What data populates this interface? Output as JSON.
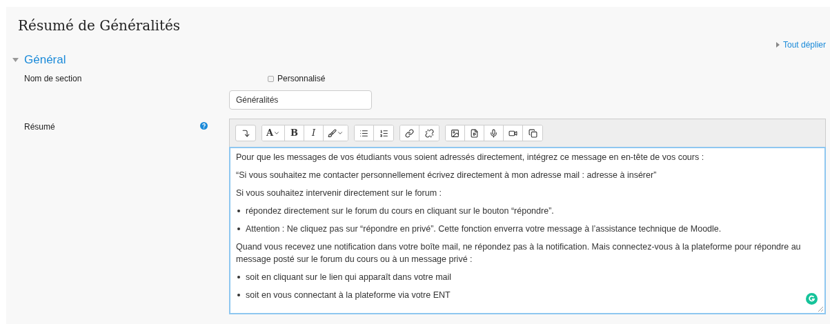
{
  "page_title": "Résumé de Généralités",
  "expand_all": "Tout déplier",
  "section": {
    "title": "Général",
    "expanded": true
  },
  "fields": {
    "name_label": "Nom de section",
    "custom_label": "Personnalisé",
    "custom_checked": false,
    "name_value": "Généralités",
    "summary_label": "Résumé"
  },
  "toolbar": {
    "font": "A",
    "bold": "B",
    "italic": "I"
  },
  "content": [
    {
      "kind": "p",
      "text": "Pour que les messages de vos étudiants vous soient adressés directement, intégrez ce message en en-tête de vos cours :"
    },
    {
      "kind": "p",
      "text": "“Si vous souhaitez me contacter personnellement écrivez directement à mon adresse mail : adresse à insérer”"
    },
    {
      "kind": "p",
      "text": "Si vous souhaitez intervenir directement sur le forum :"
    },
    {
      "kind": "li",
      "text": "répondez directement sur le forum du cours en cliquant sur le bouton “répondre”."
    },
    {
      "kind": "li",
      "text": "Attention : Ne cliquez pas sur “répondre en privé”. Cette fonction enverra votre message à l’assistance technique de Moodle."
    },
    {
      "kind": "p",
      "text": "Quand vous recevez une notification dans votre boîte mail, ne répondez pas à la notification. Mais connectez-vous à la plateforme pour répondre au message posté sur le forum du cours ou à un message privé :"
    },
    {
      "kind": "li",
      "text": "soit en cliquant sur le lien qui apparaît dans votre mail"
    },
    {
      "kind": "li",
      "text": "soit en vous connectant à la plateforme via votre ENT"
    }
  ]
}
